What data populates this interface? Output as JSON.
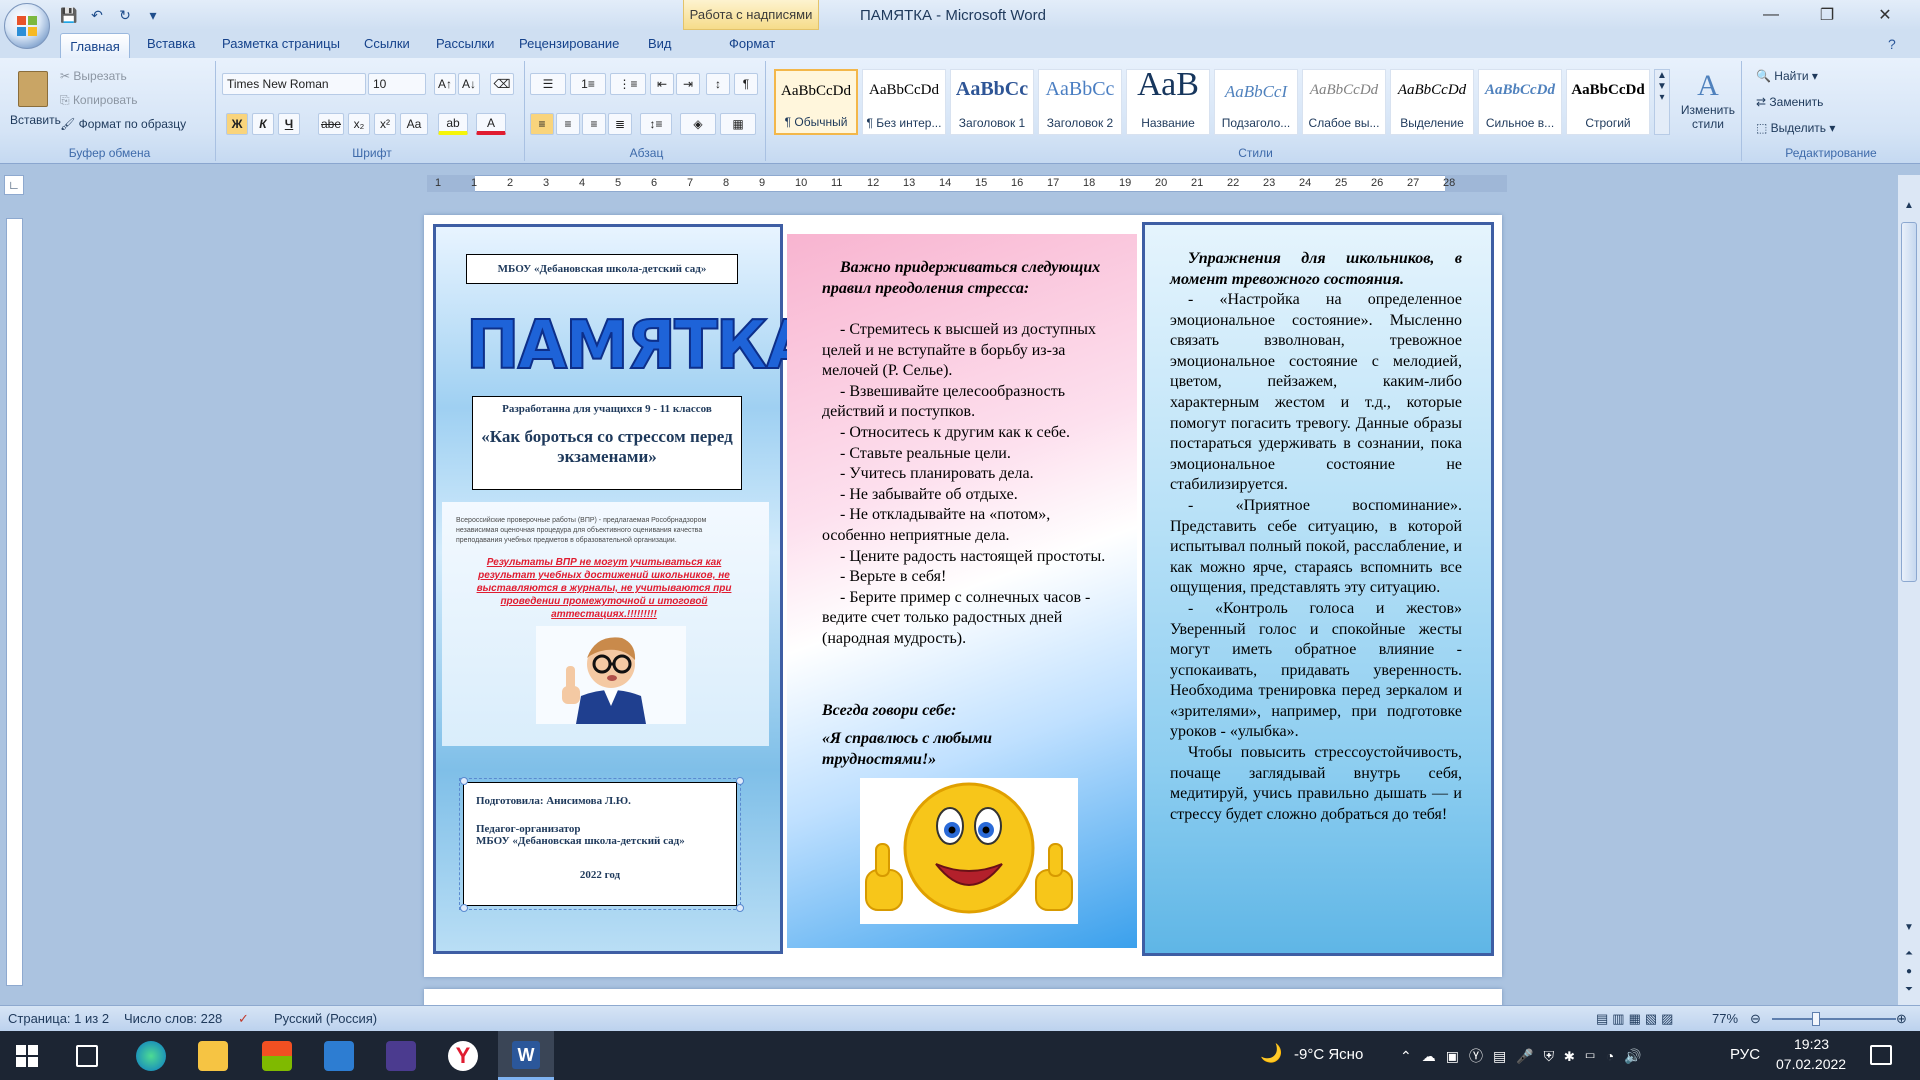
{
  "window": {
    "title": "ПАМЯТКА - Microsoft Word",
    "context_tab": "Работа с надписями"
  },
  "tabs": [
    "Главная",
    "Вставка",
    "Разметка страницы",
    "Ссылки",
    "Рассылки",
    "Рецензирование",
    "Вид",
    "Формат"
  ],
  "ribbon": {
    "clipboard": {
      "label": "Буфер обмена",
      "paste": "Вставить",
      "cut": "Вырезать",
      "copy": "Копировать",
      "format_painter": "Формат по образцу"
    },
    "font": {
      "label": "Шрифт",
      "font_name": "Times New Roman",
      "font_size": "10"
    },
    "paragraph": {
      "label": "Абзац"
    },
    "styles": {
      "label": "Стили",
      "items": [
        {
          "sample": "AaBbCcDd",
          "name": "¶ Обычный"
        },
        {
          "sample": "AaBbCcDd",
          "name": "¶ Без интер..."
        },
        {
          "sample": "AaBbCc",
          "name": "Заголовок 1"
        },
        {
          "sample": "AaBbCc",
          "name": "Заголовок 2"
        },
        {
          "sample": "АаВ",
          "name": "Название"
        },
        {
          "sample": "AaBbCcI",
          "name": "Подзаголо..."
        },
        {
          "sample": "AaBbCcDd",
          "name": "Слабое вы..."
        },
        {
          "sample": "AaBbCcDd",
          "name": "Выделение"
        },
        {
          "sample": "AaBbCcDd",
          "name": "Сильное в..."
        },
        {
          "sample": "AaBbCcDd",
          "name": "Строгий"
        }
      ],
      "change": "Изменить стили"
    },
    "editing": {
      "label": "Редактирование",
      "find": "Найти",
      "replace": "Заменить",
      "select": "Выделить"
    }
  },
  "ruler_numbers": [
    "1",
    "1",
    "2",
    "3",
    "4",
    "5",
    "6",
    "7",
    "8",
    "9",
    "10",
    "11",
    "12",
    "13",
    "14",
    "15",
    "16",
    "17",
    "18",
    "19",
    "20",
    "21",
    "22",
    "23",
    "24",
    "25",
    "26",
    "27",
    "28"
  ],
  "document": {
    "col1": {
      "school": "МБОУ «Дебановская школа-детский сад»",
      "banner": "ПАМЯТКА",
      "for_students": "Разработанна для учащихся 9 - 11 классов",
      "topic": "«Как бороться  со стрессом перед экзаменами»",
      "vpr_text": "Всероссийские проверочные работы (ВПР) - предлагаемая Рособрнадзором независимая оценочная процедура для объективного оценивания качества преподавания учебных предметов в образовательной организации.",
      "vpr_red": "Результаты ВПР не могут учитываться как результат учебных достижений школьников, не выставляются в журналы, не учитываются при проведении промежуточной и итоговой аттестациях.!!!!!!!!!",
      "prepared": "Подготовила: Анисимова Л.Ю.",
      "role": "Педагог-организатор",
      "school2": "МБОУ «Дебановская школа-детский сад»",
      "year": "2022 год"
    },
    "col2": {
      "heading": "Важно придерживаться следующих правил преодоления стресса:",
      "rules": [
        "- Стремитесь к высшей из доступных целей и не вступайте в борьбу из-за мелочей (Р. Селье).",
        "- Взвешивайте целесообразность действий и поступков.",
        "- Относитесь к другим как к себе.",
        "- Ставьте реальные цели.",
        "- Учитесь планировать дела.",
        "- Не забывайте об отдыхе.",
        "- Не откладывайте на «потом», особенно неприятные дела.",
        "- Цените радость настоящей простоты.",
        "- Верьте в себя!",
        "- Берите пример с солнечных часов - ведите счет только радостных дней (народная мудрость)."
      ],
      "say": "Всегда говори себе:",
      "motto": "«Я справлюсь с любыми трудностями!»"
    },
    "col3": {
      "heading": "Упражнения для школьников, в момент тревожного состояния.",
      "paragraphs": [
        "- «Настройка на определенное эмоциональное состояние». Мысленно связать взволнован, тревожное эмоциональное состояние с мелодией, цветом, пейзажем, каким-либо характерным жестом и т.д., которые помогут погасить тревогу. Данные образы постараться удерживать в сознании, пока эмоциональное состояние не стабилизируется.",
        "- «Приятное воспоминание». Представить себе ситуацию, в которой испытывал полный покой, расслабление, и как можно ярче, стараясь вспомнить все ощущения, представлять эту ситуацию.",
        "- «Контроль голоса и жестов» Уверенный голос и спокойные жесты могут иметь обратное влияние - успокаивать, придавать уверенность. Необходима тренировка перед зеркалом и «зрителями», например, при подготовке уроков - «улыбка».",
        "Чтобы повысить стрессоустойчивость, почаще заглядывай внутрь себя, медитируй, учись правильно дышать — и стрессу будет сложно добраться до тебя!"
      ]
    }
  },
  "status": {
    "page": "Страница: 1 из 2",
    "words": "Число слов: 228",
    "lang": "Русский (Россия)",
    "zoom": "77%"
  },
  "taskbar": {
    "weather": "-9°C  Ясно",
    "lang": "РУС",
    "time": "19:23",
    "date": "07.02.2022"
  },
  "colors": {
    "accent": "#2b579a",
    "ribbon": "#d5e4f6",
    "red": "#e01c30",
    "taskbar": "#1c2533"
  }
}
